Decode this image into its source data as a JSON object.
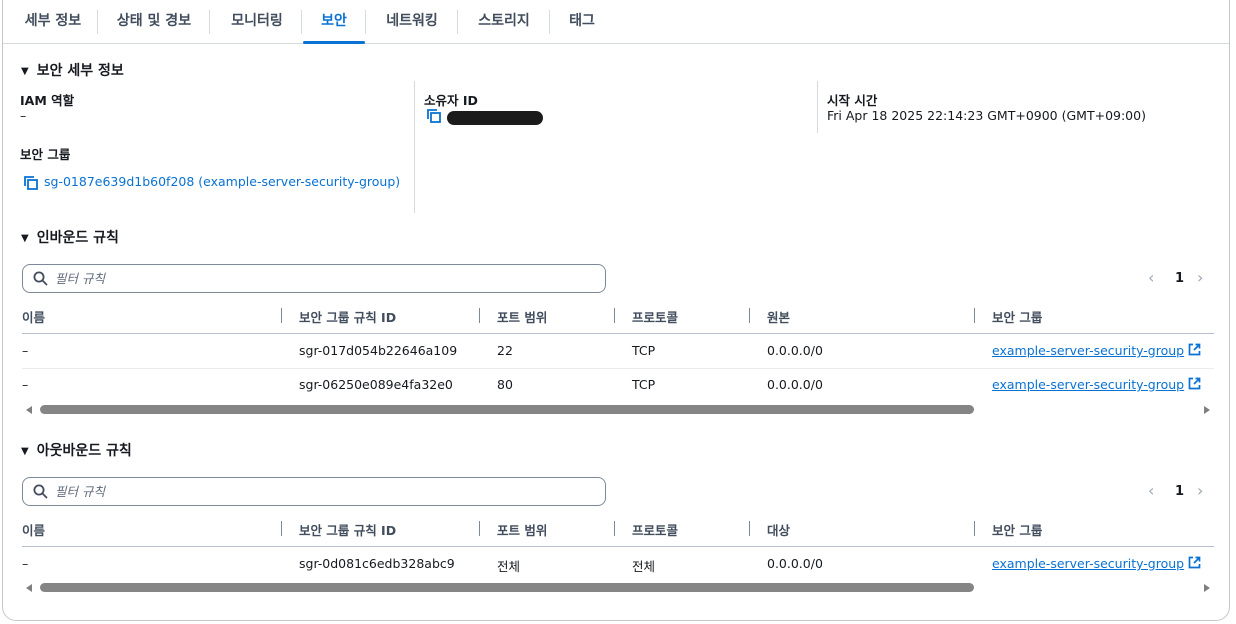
{
  "tabs": [
    {
      "label": "세부 정보"
    },
    {
      "label": "상태 및 경보"
    },
    {
      "label": "모니터링"
    },
    {
      "label": "보안",
      "active": true
    },
    {
      "label": "네트워킹"
    },
    {
      "label": "스토리지"
    },
    {
      "label": "태그"
    }
  ],
  "security_details": {
    "heading": "보안 세부 정보",
    "iam_role_label": "IAM 역할",
    "iam_role_value": "–",
    "owner_id_label": "소유자 ID",
    "launch_time_label": "시작 시간",
    "launch_time_value": "Fri Apr 18 2025 22:14:23 GMT+0900 (GMT+09:00)",
    "security_groups_label": "보안 그룹",
    "security_group_link": "sg-0187e639d1b60f208 (example-server-security-group)"
  },
  "inbound": {
    "heading": "인바운드 규칙",
    "filter_placeholder": "필터 규칙",
    "page": "1",
    "columns": [
      "이름",
      "보안 그룹 규칙 ID",
      "포트 범위",
      "프로토콜",
      "원본",
      "보안 그룹"
    ],
    "rows": [
      {
        "name": "–",
        "rule_id": "sgr-017d054b22646a109",
        "port": "22",
        "protocol": "TCP",
        "source": "0.0.0.0/0",
        "group": "example-server-security-group"
      },
      {
        "name": "–",
        "rule_id": "sgr-06250e089e4fa32e0",
        "port": "80",
        "protocol": "TCP",
        "source": "0.0.0.0/0",
        "group": "example-server-security-group"
      }
    ]
  },
  "outbound": {
    "heading": "아웃바운드 규칙",
    "filter_placeholder": "필터 규칙",
    "page": "1",
    "columns": [
      "이름",
      "보안 그룹 규칙 ID",
      "포트 범위",
      "프로토콜",
      "대상",
      "보안 그룹"
    ],
    "rows": [
      {
        "name": "–",
        "rule_id": "sgr-0d081c6edb328abc9",
        "port": "전체",
        "protocol": "전체",
        "source": "0.0.0.0/0",
        "group": "example-server-security-group"
      }
    ]
  },
  "colors": {
    "accent": "#0972d3",
    "text": "#16191f",
    "border": "#d5dbdb"
  },
  "icons": [
    "caret-down-icon",
    "copy-icon",
    "search-icon",
    "chevron-left-icon",
    "chevron-right-icon",
    "external-link-icon"
  ]
}
